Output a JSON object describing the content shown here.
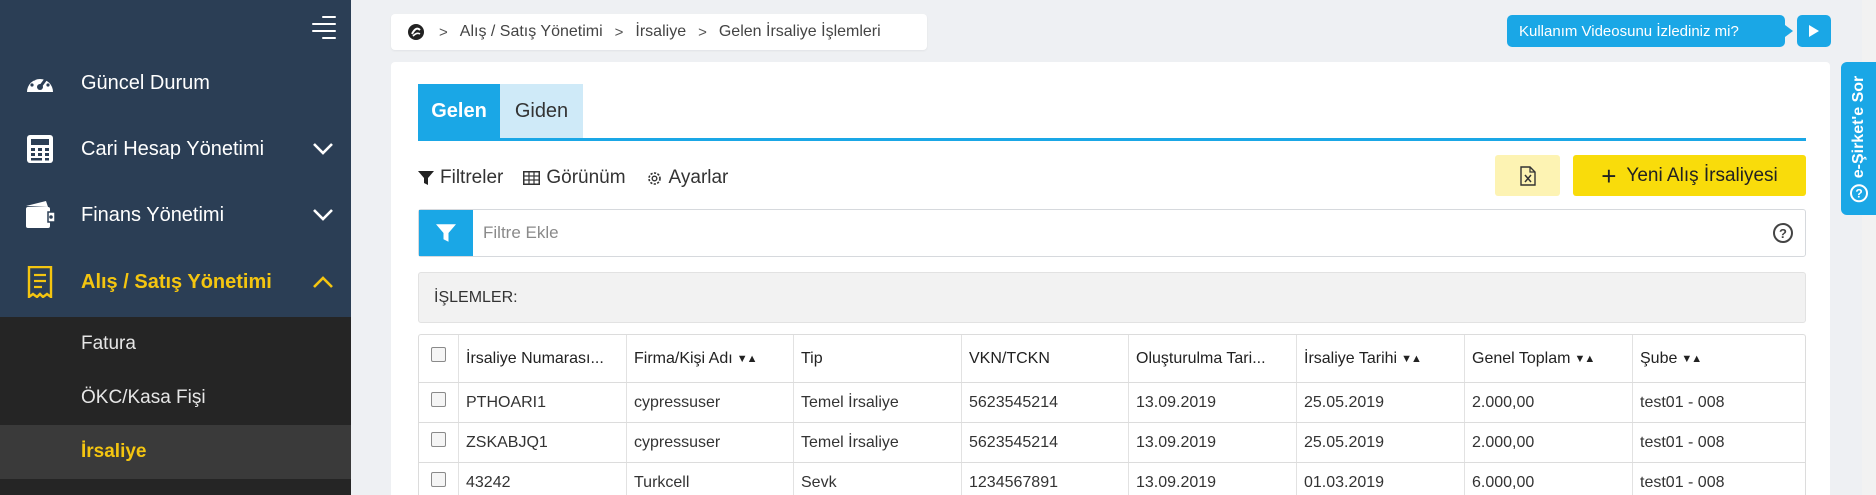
{
  "sidebar": {
    "items": [
      {
        "label": "Güncel Durum",
        "icon": "dashboard-gauge-icon"
      },
      {
        "label": "Cari Hesap Yönetimi",
        "icon": "calculator-icon"
      },
      {
        "label": "Finans Yönetimi",
        "icon": "wallet-icon"
      },
      {
        "label": "Alış / Satış Yönetimi",
        "icon": "receipt-icon"
      }
    ],
    "submenu": [
      {
        "label": "Fatura"
      },
      {
        "label": "ÖKC/Kasa Fişi"
      },
      {
        "label": "İrsaliye"
      }
    ],
    "active_color": "#f4c510",
    "background": "#2b3e55"
  },
  "breadcrumb": {
    "items": [
      "Alış / Satış Yönetimi",
      "İrsaliye",
      "Gelen İrsaliye İşlemleri"
    ]
  },
  "help": {
    "video_tip": "Kullanım Videosunu İzlediniz mi?",
    "side_tab": "e-Şirket'e Sor"
  },
  "tabs": [
    {
      "label": "Gelen",
      "selected": true
    },
    {
      "label": "Giden",
      "selected": false
    }
  ],
  "toolbar": {
    "filters": "Filtreler",
    "view": "Görünüm",
    "settings": "Ayarlar",
    "new_button": "Yeni Alış İrsaliyesi"
  },
  "filter": {
    "placeholder": "Filtre Ekle"
  },
  "section": {
    "title": "İŞLEMLER:"
  },
  "table": {
    "columns": [
      "İrsaliye Numarası...",
      "Firma/Kişi Adı",
      "Tip",
      "VKN/TCKN",
      "Oluşturulma Tari...",
      "İrsaliye Tarihi",
      "Genel Toplam",
      "Şube"
    ],
    "rows": [
      [
        "PTHOARI1",
        "cypressuser",
        "Temel İrsaliye",
        "5623545214",
        "13.09.2019",
        "25.05.2019",
        "2.000,00",
        "test01 - 008"
      ],
      [
        "ZSKABJQ1",
        "cypressuser",
        "Temel İrsaliye",
        "5623545214",
        "13.09.2019",
        "25.05.2019",
        "2.000,00",
        "test01 - 008"
      ],
      [
        "43242",
        "Turkcell",
        "Sevk",
        "1234567891",
        "13.09.2019",
        "01.03.2019",
        "6.000,00",
        "test01 - 008"
      ]
    ]
  },
  "colors": {
    "accent": "#1aa7e6",
    "primary_button": "#f9dc0b"
  }
}
